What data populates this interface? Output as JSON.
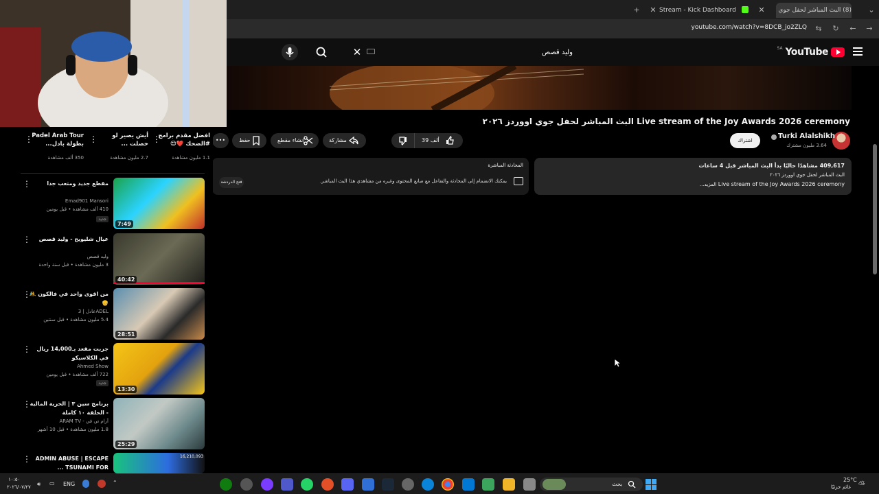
{
  "browser": {
    "tabs": [
      {
        "label": "(8) البث المباشر لحفل جوي ار",
        "active": true
      },
      {
        "label": "Stream - Kick Dashboard",
        "active": false
      }
    ],
    "url": "youtube.com/watch?v=8DCB_jo2ZLQ"
  },
  "youtube": {
    "logo_text": "YouTube",
    "region": "SA",
    "search": {
      "value": "وليد قصص",
      "placeholder": "بحث"
    }
  },
  "video": {
    "title": "Live stream of the Joy Awards 2026 ceremony البث المباشر لحفل جوي اووردز ٢٠٢٦",
    "channel": "Turki Alalshikh",
    "subscribers": "3.64 مليون مشترك",
    "subscribe_label": "اشتراك",
    "actions": {
      "like": "39 ألف",
      "share": "مشاركة",
      "clip": "إنشاء مقطع",
      "save": "حفظ"
    }
  },
  "description": {
    "views": "409,617 مشاهدًا حاليًا بدأ البث المباشر قبل 4 ساعات",
    "line1": "البث المباشر لحفل جوي اووردز ٢٠٢٦",
    "line2": "Live stream of the Joy Awards 2026 ceremony",
    "more": "...المزيد"
  },
  "chat": {
    "title": "المحادثة المباشرة",
    "description": "يمكنك الانضمام إلى المحادثة والتفاعل مع صانع المحتوى وغيره من مشاهدي هذا البث المباشر.",
    "open_label": "فتح الدردشة"
  },
  "shorts": [
    {
      "title": "Padel Arab Tour بطولة بادل...",
      "views": "350 ألف مشاهدة"
    },
    {
      "title": "أيش يصير لو حصلت ...",
      "views": "2.7 مليون مشاهدة"
    },
    {
      "title": "افضل مقدم برامج #الضحك ❤️😍",
      "views": "1.1 مليون مشاهدة"
    }
  ],
  "related": [
    {
      "title": "مقطع جديد ومتعب جدا",
      "channel": "Emad901 Mansori",
      "meta": "410 ألف مشاهدة • قبل يومين",
      "badge": "جديد",
      "duration": "7:49"
    },
    {
      "title": "عيال شليويح - وليد قصص",
      "channel": "وليد قصص",
      "meta": "3 مليون مشاهدة • قبل سنة واحدة",
      "badge": "",
      "duration": "40:42"
    },
    {
      "title": "من اقوى واحد في فالكون 🤼👴",
      "channel": "عادل | 3ADEL",
      "meta": "5.4 مليون مشاهدة • قبل سنتين",
      "badge": "",
      "duration": "28:51"
    },
    {
      "title": "جربت مقعد بـ14,000 ريال في الكلاسيكو",
      "channel": "Ahmed Show",
      "meta": "722 ألف مشاهدة • قبل يومين",
      "badge": "جديد",
      "duration": "13:30"
    },
    {
      "title": "برنامج سين ٣ | الحرية المالية - الحلقة ١٠ كاملة",
      "channel": "ARAM TV - آرام تي في",
      "meta": "1.8 مليون مشاهدة • قبل 10 أشهر",
      "badge": "",
      "duration": "25:29"
    },
    {
      "title": "ADMIN ABUSE | ESCAPE TSUNAMI FOR ...",
      "channel": "",
      "meta": "",
      "badge": "",
      "duration": "16,210,093"
    }
  ],
  "taskbar": {
    "time": "١٠:٥٠",
    "date": "٢٠٢٦/٠٧/٢٧",
    "lang": "ENG",
    "search_label": "بحث",
    "weather_temp": "25°C",
    "weather_desc": "غائم جزئيًا"
  },
  "colors": {
    "youtube_red": "#ff0033",
    "background": "#0f0f0f",
    "card": "#272727"
  }
}
